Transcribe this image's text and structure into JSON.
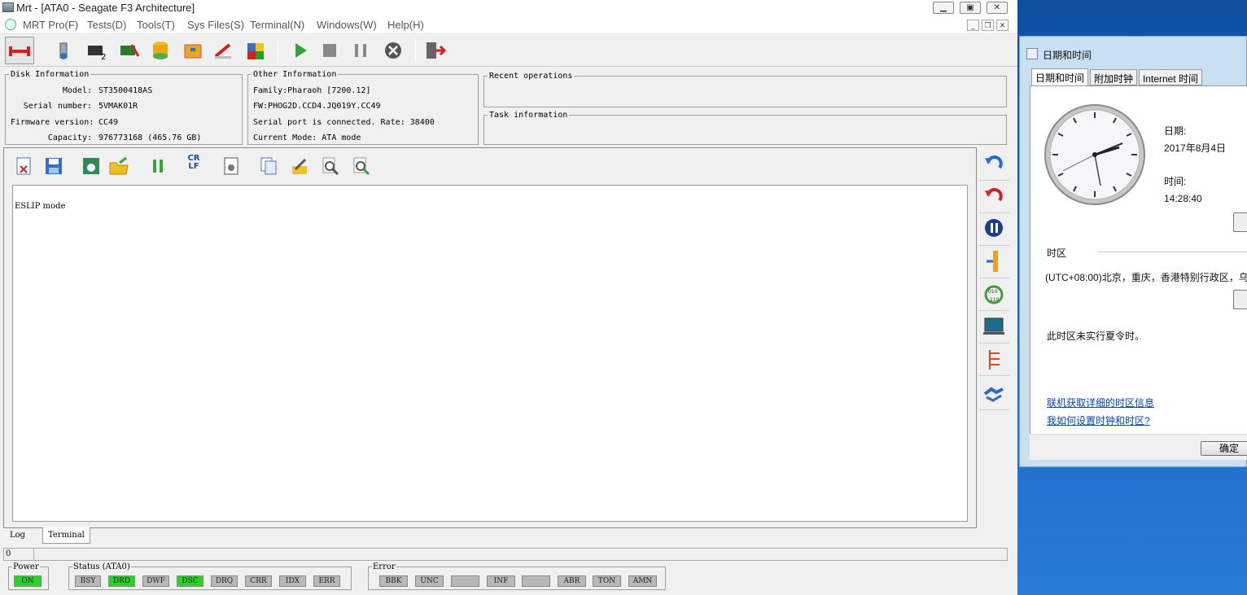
{
  "window": {
    "title": "Mrt - [ATA0 - Seagate F3 Architecture]",
    "min_label": "▭",
    "max_label": "□",
    "close_label": "✕"
  },
  "menu": [
    {
      "label": "MRT Pro(F)"
    },
    {
      "label": "Tests(D)"
    },
    {
      "label": "Tools(T)"
    },
    {
      "label": "Sys Files(S)"
    },
    {
      "label": "Terminal(N)"
    },
    {
      "label": "Windows(W)"
    },
    {
      "label": "Help(H)"
    }
  ],
  "disk_info": {
    "legend": "Disk Information",
    "rows": [
      {
        "label": "Model:",
        "value": "ST3500418AS"
      },
      {
        "label": "Serial number:",
        "value": "5VMAK01R"
      },
      {
        "label": "Firmware version:",
        "value": "CC49"
      },
      {
        "label": "Capacity:",
        "value": "976773168 (465.76 GB)"
      }
    ]
  },
  "other_info": {
    "legend": "Other Information",
    "rows": [
      "Family:Pharaoh [7200.12]",
      "FW:PHOG2D.CCD4.JQ019Y.CC49",
      "Serial port is connected. Rate: 38400",
      "Current Mode: ATA mode"
    ]
  },
  "recent_ops": {
    "legend": "Recent operations"
  },
  "task_info": {
    "legend": "Task information"
  },
  "terminal": {
    "output_line": "ESLIP mode",
    "crlf_label": "CR LF"
  },
  "tabs": [
    {
      "label": "Log"
    },
    {
      "label": "Terminal"
    }
  ],
  "status_line_value": "0",
  "power": {
    "legend": "Power",
    "indicator": "ON"
  },
  "status": {
    "legend": "Status (ATA0)",
    "indicators": [
      {
        "label": "BSY",
        "on": false
      },
      {
        "label": "DRD",
        "on": true
      },
      {
        "label": "DWF",
        "on": false
      },
      {
        "label": "DSC",
        "on": true
      },
      {
        "label": "DRQ",
        "on": false
      },
      {
        "label": "CRR",
        "on": false
      },
      {
        "label": "IDX",
        "on": false
      },
      {
        "label": "ERR",
        "on": false
      }
    ]
  },
  "error": {
    "legend": "Error",
    "indicators": [
      "BBK",
      "UNC",
      "",
      "INF",
      "",
      "ABR",
      "TON",
      "AMN"
    ]
  },
  "colors": {
    "indicator_on": "#28d428",
    "indicator_off": "#b8b8b8",
    "link": "#0645ad",
    "desktop": "#1d6ac9"
  },
  "datetime_dialog": {
    "title": "日期和时间",
    "tabs": [
      "日期和时间",
      "附加时钟",
      "Internet 时间"
    ],
    "date_label": "日期:",
    "date_value": "2017年8月4日",
    "time_label": "时间:",
    "time_value": "14:28:40",
    "timezone_heading": "时区",
    "timezone_value": "(UTC+08:00)北京，重庆，香港特别行政区，乌",
    "dst_note": "此时区未实行夏令时。",
    "link1": "联机获取详细的时区信息",
    "link2": "我如何设置时钟和时区?",
    "ok_button": "确定"
  }
}
